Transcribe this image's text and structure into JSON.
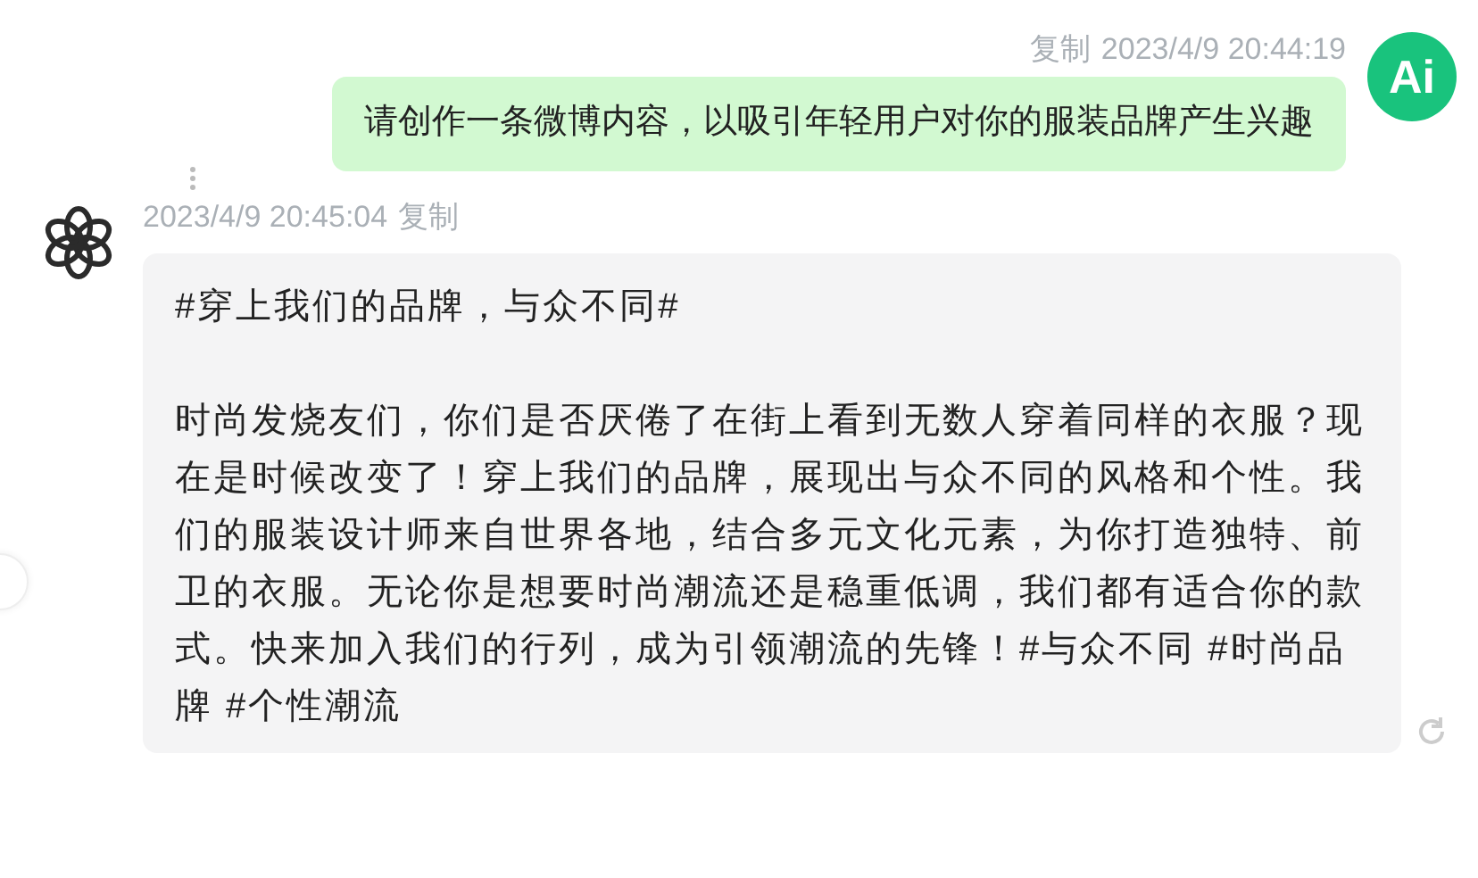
{
  "messages": [
    {
      "kind": "user",
      "copy_label": "复制",
      "time": "2023/4/9 20:44:19",
      "avatar_label": "Ai",
      "paragraphs": [
        "请创作一条微博内容，以吸引年轻用户对你的服装品牌产生兴趣"
      ]
    },
    {
      "kind": "assistant",
      "copy_label": "复制",
      "time": "2023/4/9 20:45:04",
      "paragraphs": [
        "#穿上我们的品牌，与众不同#",
        "时尚发烧友们，你们是否厌倦了在街上看到无数人穿着同样的衣服？现在是时候改变了！穿上我们的品牌，展现出与众不同的风格和个性。我们的服装设计师来自世界各地，结合多元文化元素，为你打造独特、前卫的衣服。无论你是想要时尚潮流还是稳重低调，我们都有适合你的款式。快来加入我们的行列，成为引领潮流的先锋！#与众不同 #时尚品牌 #个性潮流"
      ]
    }
  ]
}
